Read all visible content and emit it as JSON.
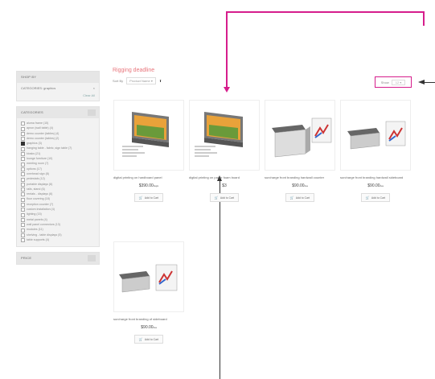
{
  "sidebar": {
    "shop_by_header": "SHOP BY",
    "current_filter": "CATEGORIES: graphics",
    "clear_all": "Clear All",
    "categories_header": "CATEGORIES",
    "categories": [
      {
        "label": "aluma frame (15)",
        "checked": false
      },
      {
        "label": "apron (wall table) (4)",
        "checked": false
      },
      {
        "label": "demo counter (tables) (4)",
        "checked": false
      },
      {
        "label": "demo counter (tables) (2)",
        "checked": false
      },
      {
        "label": "graphics (3)",
        "checked": true
      },
      {
        "label": "hanging table - fabric, sign table (7)",
        "checked": false
      },
      {
        "label": "kiosks (21)",
        "checked": false
      },
      {
        "label": "lounge furniture (10)",
        "checked": false
      },
      {
        "label": "meeting room (7)",
        "checked": false
      },
      {
        "label": "options (17)",
        "checked": false
      },
      {
        "label": "overhead sign (8)",
        "checked": false
      },
      {
        "label": "pedestals (12)",
        "checked": false
      },
      {
        "label": "portable displays (6)",
        "checked": false
      },
      {
        "label": "rails, stand (6)",
        "checked": false
      },
      {
        "label": "rentals - displays (6)",
        "checked": false
      },
      {
        "label": "floor covering (18)",
        "checked": false
      },
      {
        "label": "reception counter (7)",
        "checked": false
      },
      {
        "label": "custom installation (4)",
        "checked": false
      },
      {
        "label": "lighting (15)",
        "checked": false
      },
      {
        "label": "metal panels (4)",
        "checked": false
      },
      {
        "label": "wall panel connectors (13)",
        "checked": false
      },
      {
        "label": "modules (11)",
        "checked": false
      },
      {
        "label": "shelving - table displays (5)",
        "checked": false
      },
      {
        "label": "table supports (4)",
        "checked": false
      }
    ],
    "price_header": "PRICE"
  },
  "main": {
    "title": "Rigging deadline",
    "sort_label": "Sort By",
    "sort_value": "Product Name",
    "show_label": "Show",
    "show_value": "12"
  },
  "products": [
    {
      "name": "digital printing on hardboard panel",
      "price": "$390.00",
      "unit": "/sqm",
      "cart": "Add to Cart"
    },
    {
      "name": "digital printing on paper foam board",
      "price": "$3",
      "unit": "",
      "cart": "Add to Cart"
    },
    {
      "name": "surcharge front branding hardwall counter",
      "price": "$90.00",
      "unit": "/ea",
      "cart": "Add to Cart"
    },
    {
      "name": "surcharge front branding hardwall sideboard",
      "price": "$90.00",
      "unit": "/ea",
      "cart": "Add to Cart"
    },
    {
      "name": "surcharge front branding of sideboard",
      "price": "$90.00",
      "unit": "/ea",
      "cart": "Add to Cart"
    }
  ],
  "colors": {
    "annotation_pink": "#d61d8c",
    "title": "#e8757c"
  }
}
